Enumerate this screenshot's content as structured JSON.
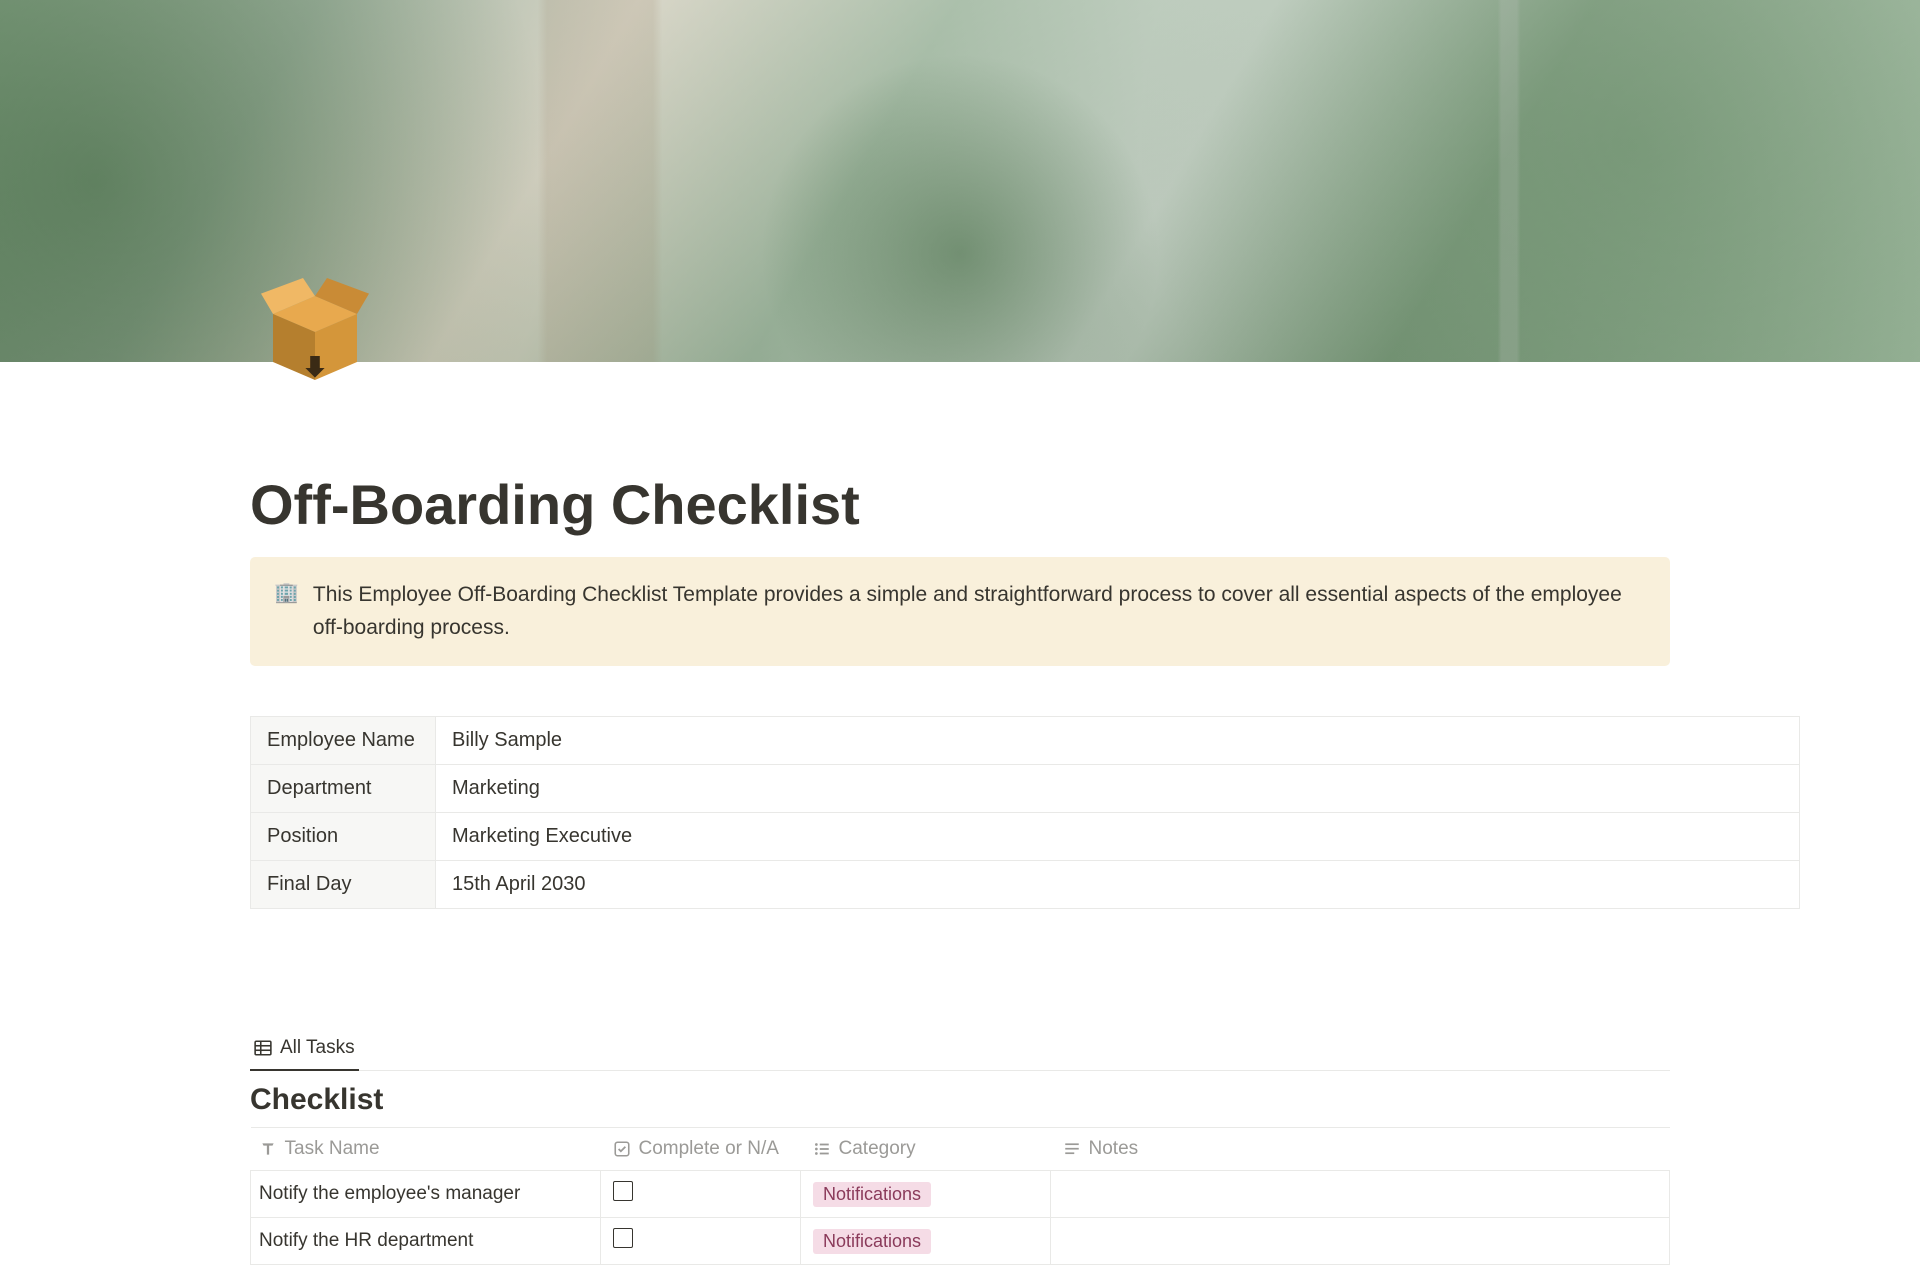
{
  "page": {
    "title": "Off-Boarding Checklist"
  },
  "callout": {
    "icon": "🏢",
    "text": "This Employee Off-Boarding Checklist Template provides a simple and straightforward process to cover all essential aspects of the employee off-boarding process."
  },
  "info": {
    "rows": [
      {
        "label": "Employee Name",
        "value": "Billy Sample"
      },
      {
        "label": "Department",
        "value": "Marketing"
      },
      {
        "label": "Position",
        "value": "Marketing Executive"
      },
      {
        "label": "Final Day",
        "value": "15th April 2030"
      }
    ]
  },
  "database": {
    "view_label": "All Tasks",
    "title": "Checklist",
    "columns": {
      "task": "Task Name",
      "complete": "Complete or N/A",
      "category": "Category",
      "notes": "Notes"
    },
    "rows": [
      {
        "task": "Notify the employee's manager",
        "complete": false,
        "category": "Notifications",
        "category_color": "pink",
        "notes": ""
      },
      {
        "task": "Notify the HR department",
        "complete": false,
        "category": "Notifications",
        "category_color": "pink",
        "notes": ""
      }
    ]
  }
}
